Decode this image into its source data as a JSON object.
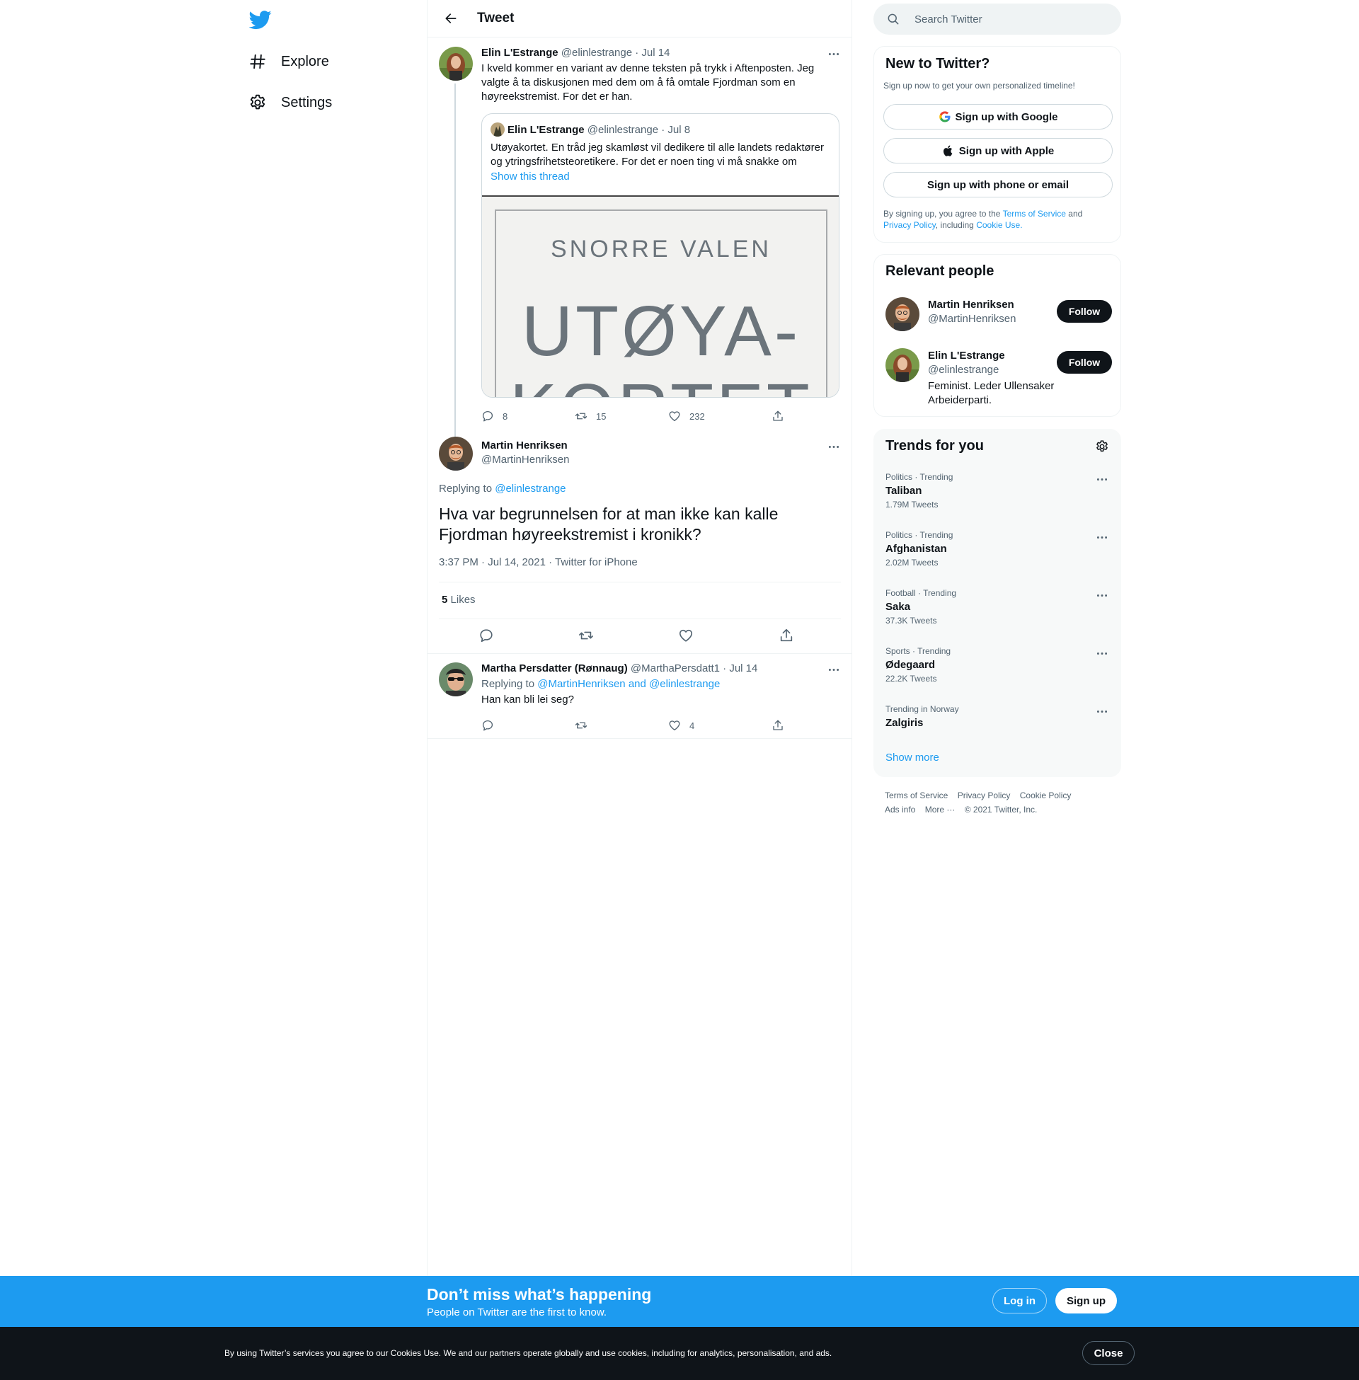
{
  "nav": {
    "explore_label": "Explore",
    "settings_label": "Settings"
  },
  "header": {
    "title": "Tweet"
  },
  "parent_tweet": {
    "name": "Elin L'Estrange",
    "handle": "@elinlestrange",
    "date": "· Jul 14",
    "text": "I kveld kommer en variant av denne teksten på trykk i Aftenposten. Jeg valgte å ta diskusjonen med dem om å få omtale Fjordman som en høyreekstremist. For det er han.",
    "quote": {
      "name": "Elin L'Estrange",
      "handle": "@elinlestrange",
      "date": "· Jul 8",
      "text": "Utøyakortet. En tråd jeg skamløst vil dedikere til alle landets redaktører og ytringsfrihetsteoretikere. For det er noen ting vi må snakke om",
      "show_thread": "Show this thread",
      "image_author": "SNORRE VALEN",
      "image_title": "UTØYA-KORTET"
    },
    "replies": "8",
    "retweets": "15",
    "likes": "232"
  },
  "focus_tweet": {
    "name": "Martin Henriksen",
    "handle": "@MartinHenriksen",
    "replying_prefix": "Replying to",
    "replying_to": "@elinlestrange",
    "text": "Hva var begrunnelsen for at man ikke kan kalle Fjordman høyreekstremist i kronikk?",
    "meta": "3:37 PM · Jul 14, 2021 · Twitter for iPhone",
    "likes_count": "5",
    "likes_label": "Likes"
  },
  "reply_tweet": {
    "name": "Martha Persdatter (Rønnaug)",
    "handle": "@MarthaPersdatt1",
    "date": "· Jul 14",
    "replying_prefix": "Replying to",
    "replying_to": "@MartinHenriksen and @elinlestrange",
    "text": "Han kan bli lei seg?",
    "likes": "4"
  },
  "search": {
    "placeholder": "Search Twitter"
  },
  "new_to_twitter": {
    "title": "New to Twitter?",
    "subtitle": "Sign up now to get your own personalized timeline!",
    "google": "Sign up with Google",
    "apple": "Sign up with Apple",
    "phone": "Sign up with phone or email",
    "legal_prefix": "By signing up, you agree to the",
    "terms": "Terms of Service",
    "and": "and",
    "privacy": "Privacy Policy",
    "including": ", including",
    "cookie": "Cookie Use."
  },
  "relevant_people": {
    "title": "Relevant people",
    "follow_label": "Follow",
    "people": [
      {
        "name": "Martin Henriksen",
        "handle": "@MartinHenriksen",
        "bio": ""
      },
      {
        "name": "Elin L'Estrange",
        "handle": "@elinlestrange",
        "bio": "Feminist. Leder Ullensaker Arbeiderparti."
      }
    ]
  },
  "trends": {
    "title": "Trends for you",
    "items": [
      {
        "meta": "Politics · Trending",
        "name": "Taliban",
        "count": "1.79M Tweets"
      },
      {
        "meta": "Politics · Trending",
        "name": "Afghanistan",
        "count": "2.02M Tweets"
      },
      {
        "meta": "Football · Trending",
        "name": "Saka",
        "count": "37.3K Tweets"
      },
      {
        "meta": "Sports · Trending",
        "name": "Ødegaard",
        "count": "22.2K Tweets"
      },
      {
        "meta": "Trending in Norway",
        "name": "Zalgiris",
        "count": ""
      }
    ],
    "show_more": "Show more"
  },
  "footer": {
    "terms": "Terms of Service",
    "privacy": "Privacy Policy",
    "cookie": "Cookie Policy",
    "ads": "Ads info",
    "more": "More ···",
    "copyright": "© 2021 Twitter, Inc."
  },
  "bottom_bar": {
    "title": "Don’t miss what’s happening",
    "subtitle": "People on Twitter are the first to know.",
    "login": "Log in",
    "signup": "Sign up"
  },
  "cookie_bar": {
    "text": "By using Twitter’s services you agree to our Cookies Use. We and our partners operate globally and use cookies, including for analytics, personalisation, and ads.",
    "close": "Close"
  },
  "colors": {
    "accent": "#1d9bf0",
    "text": "#0f1419",
    "muted": "#536471",
    "border": "#eff3f4",
    "cookie_bg": "#0f1419"
  }
}
